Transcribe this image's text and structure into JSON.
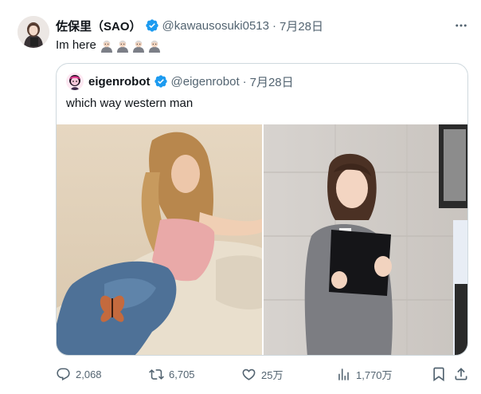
{
  "tweet": {
    "author_name": "佐保里（SAO）",
    "handle": "@kawausosuki0513",
    "separator": "·",
    "date": "7月28日",
    "text": "Im here",
    "emoji": [
      "person-emoji",
      "person-emoji",
      "person-emoji",
      "person-emoji"
    ]
  },
  "quote": {
    "author_name": "eigenrobot",
    "handle": "@eigenrobot",
    "separator": "·",
    "date": "7月28日",
    "text": "which way western man"
  },
  "actions": {
    "replies": "2,068",
    "reposts": "6,705",
    "likes": "25万",
    "views": "1,770万"
  },
  "colors": {
    "text": "#0f1419",
    "secondary": "#536471",
    "verified": "#1d9bf0",
    "border": "#cfd9de"
  }
}
